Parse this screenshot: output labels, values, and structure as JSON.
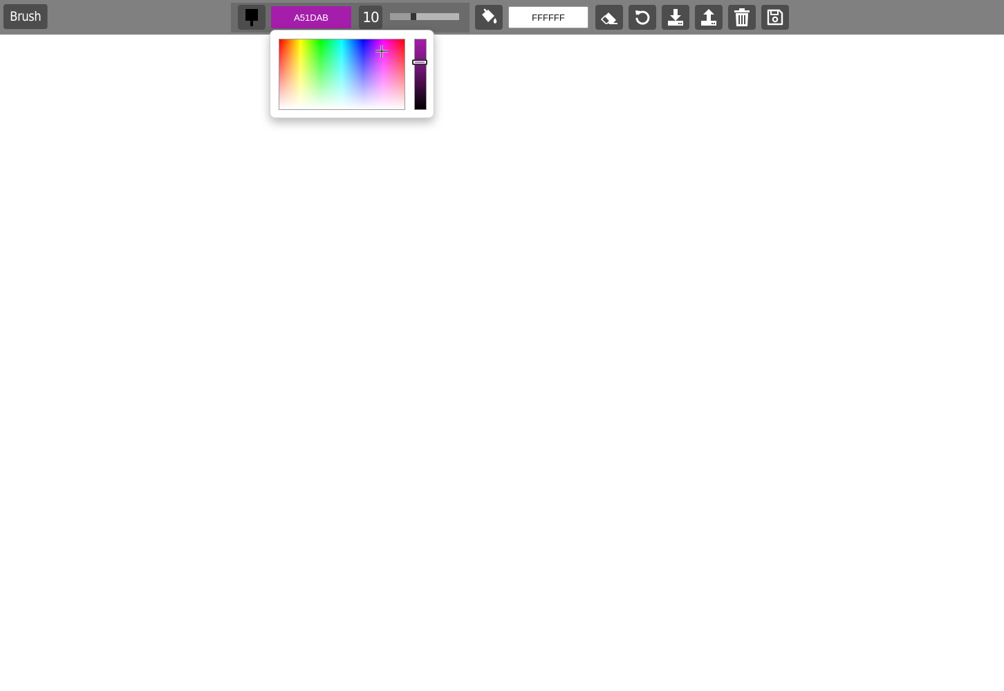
{
  "toolbar": {
    "mode_label": "Brush",
    "brush_color_hex": "A51DAB",
    "brush_color_css": "#a51dab",
    "brush_size": "10",
    "brush_size_value": 10,
    "brush_size_min": 1,
    "brush_size_max": 50,
    "background_color_hex": "FFFFFF",
    "icons": {
      "brush": "paint-brush-icon",
      "fill": "paint-bucket-icon",
      "eraser": "eraser-icon",
      "undo": "undo-icon",
      "download": "download-icon",
      "upload": "upload-icon",
      "clear": "trash-icon",
      "save": "save-icon"
    }
  },
  "color_picker": {
    "open": true,
    "hue_saturation": {
      "hue_fraction": 0.82,
      "saturation_fraction": 0.83
    },
    "value_fraction": 0.67
  },
  "colors": {
    "toolbar_bg": "#808080",
    "button_bg": "#4d4d4d",
    "group_bg": "#6b6b6b",
    "canvas_bg": "#ffffff",
    "accent": "#a51dab"
  }
}
